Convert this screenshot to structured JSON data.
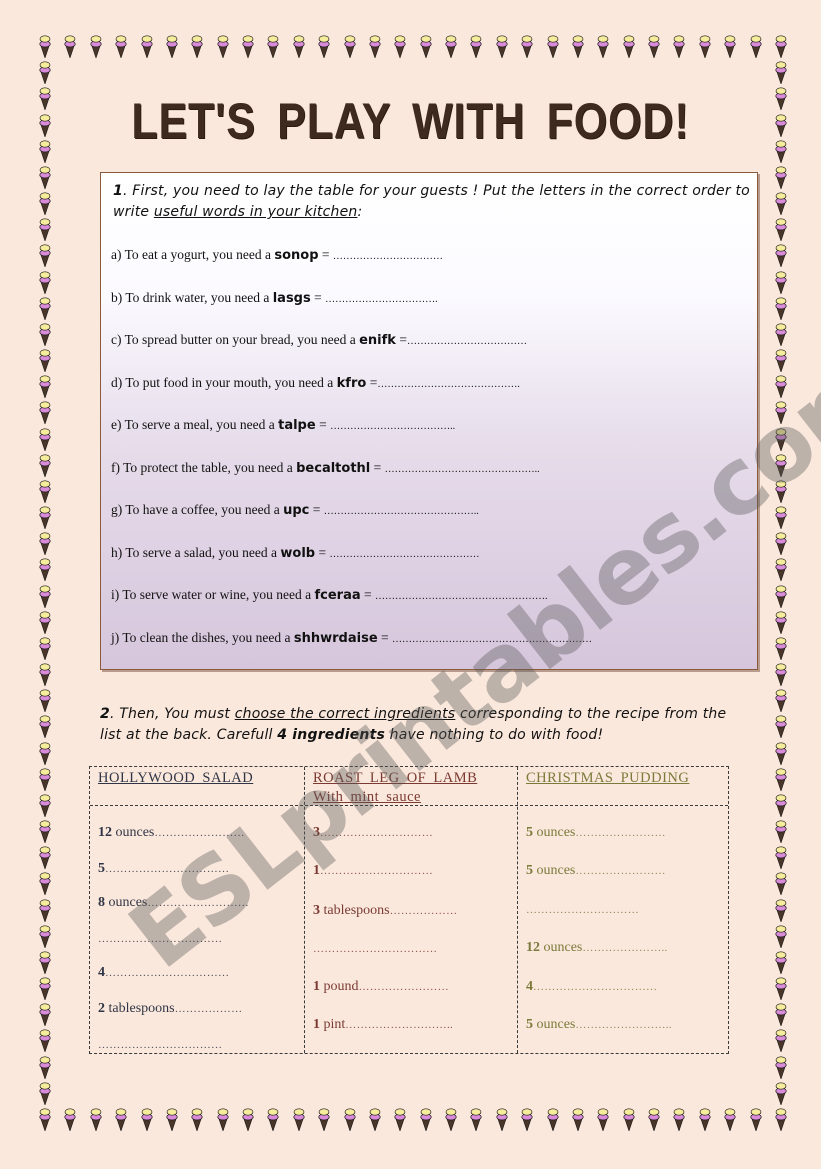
{
  "title": "LET'S PLAY WITH FOOD!",
  "border": {
    "icon": "ice-cream-cone-icon",
    "colors": {
      "scoop_top": "#f5ec9c",
      "scoop_bottom": "#d98ad8",
      "cone": "#4a3628",
      "outline": "#1a1a1a"
    }
  },
  "exercise1": {
    "number": "1",
    "instruction_part1": ". First, you need to lay the table for your guests ! Put the letters in the correct order to write ",
    "instruction_underlined": "useful words in your kitchen",
    "instruction_part3": ":",
    "questions": [
      {
        "prefix": "a) To eat a yogurt, you need a ",
        "word": "sonop",
        "suffix": " = ",
        "dots": "……………………………"
      },
      {
        "prefix": "b) To drink water, you need a ",
        "word": "lasgs",
        "suffix": "  = ",
        "dots": "……………………………."
      },
      {
        "prefix": "c) To spread butter on your bread, you need a ",
        "word": "enifk",
        "suffix": " =",
        "dots": "………………………………"
      },
      {
        "prefix": "d) To put food in your mouth, you need a ",
        "word": "kfro",
        "suffix": "  =",
        "dots": "……………………………………."
      },
      {
        "prefix": "e) To serve a meal, you need a ",
        "word": "talpe",
        "suffix": " = ",
        "dots": "……………………………….."
      },
      {
        "prefix": "f) To protect the table, you need a ",
        "word": "becaltothl",
        "suffix": "  = ",
        "dots": "……………………………………….."
      },
      {
        "prefix": "g) To have a coffee, you need a ",
        "word": "upc",
        "suffix": " = ",
        "dots": "……………………………………….."
      },
      {
        "prefix": "h) To serve a salad, you need a ",
        "word": "wolb",
        "suffix": " = ",
        "dots": "………………………………………"
      },
      {
        "prefix": "i) To serve water or wine, you need a ",
        "word": "fceraa",
        "suffix": " = ",
        "dots": "……………………………………………."
      },
      {
        "prefix": "j) To clean the dishes, you need a ",
        "word": "shhwrdaise",
        "suffix": " = ",
        "dots": "……………………………………………………"
      }
    ]
  },
  "exercise2": {
    "number": "2",
    "instruction_part1": ". Then, You must ",
    "instruction_underlined": "choose the correct ingredients",
    "instruction_part3": " corresponding to the recipe from the list at the back. Carefull ",
    "instruction_bold": "4  ingredients",
    "instruction_part5": " have nothing to do with food!",
    "recipes": [
      {
        "title": "HOLLYWOOD  SALAD",
        "subtitle": "",
        "ingredients": [
          {
            "qty": "12",
            "unit": " ounces",
            "dots": "……………………"
          },
          {
            "qty": "5",
            "unit": "",
            "dots": "……………………………"
          },
          {
            "qty": "8",
            "unit": " ounces",
            "dots": "………………………"
          },
          {
            "qty": "",
            "unit": "",
            "dots": "……………………………"
          },
          {
            "qty": "4",
            "unit": "",
            "dots": "……………………………"
          },
          {
            "qty": "2",
            "unit": " tablespoons",
            "dots": "………………"
          },
          {
            "qty": "",
            "unit": "",
            "dots": "……………………………"
          }
        ]
      },
      {
        "title": "ROAST  LEG  OF  LAMB",
        "subtitle": "With  mint  sauce",
        "ingredients": [
          {
            "qty": "3",
            "unit": "",
            "dots": "…………………………"
          },
          {
            "qty": "1",
            "unit": "",
            "dots": "…………………………"
          },
          {
            "qty": "3",
            "unit": " tablespoons",
            "dots": "………………"
          },
          {
            "qty": "",
            "unit": "",
            "dots": "……………………………"
          },
          {
            "qty": "1",
            "unit": " pound",
            "dots": "……………………"
          },
          {
            "qty": "1",
            "unit": " pint",
            "dots": "……………………….."
          }
        ]
      },
      {
        "title": "CHRISTMAS  PUDDING",
        "subtitle": "",
        "ingredients": [
          {
            "qty": "5",
            "unit": " ounces",
            "dots": "……………………"
          },
          {
            "qty": "5",
            "unit": " ounces",
            "dots": "……………………"
          },
          {
            "qty": "",
            "unit": "",
            "dots": "…………………………"
          },
          {
            "qty": "12",
            "unit": " ounces",
            "dots": "………………….."
          },
          {
            "qty": "4",
            "unit": "",
            "dots": "……………………………"
          },
          {
            "qty": "5",
            "unit": " ounces",
            "dots": "…………………….."
          }
        ]
      }
    ]
  },
  "watermark": "ESLprintables.com"
}
